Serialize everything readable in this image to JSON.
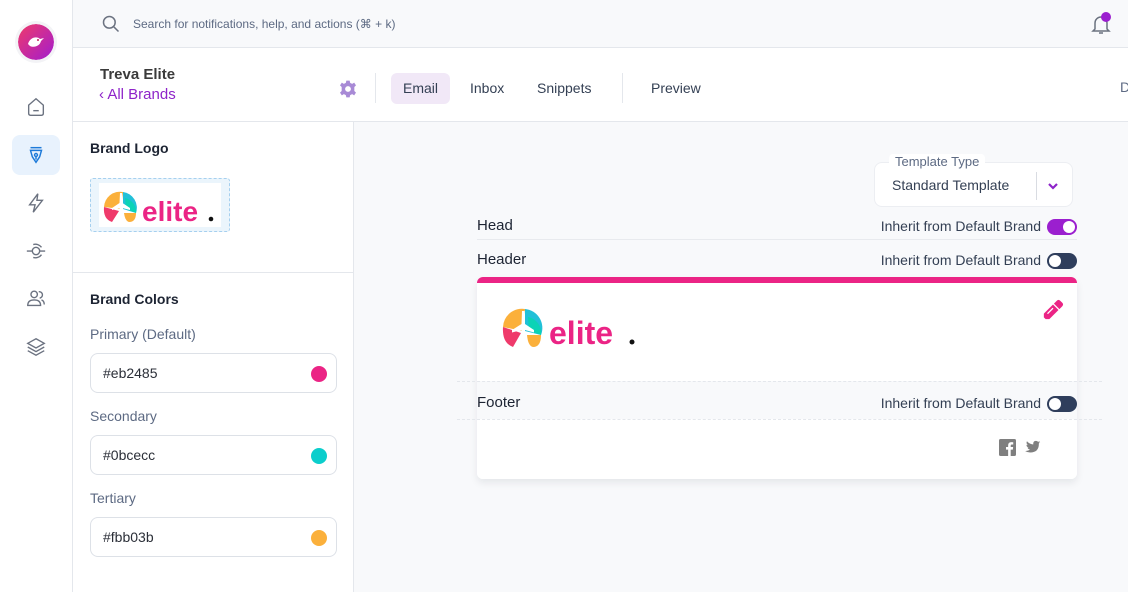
{
  "app": {
    "logo_icon": "bird-logo-icon"
  },
  "rail": {
    "items": [
      {
        "name": "home",
        "icon": "home-icon",
        "active": false
      },
      {
        "name": "brands",
        "icon": "pen-nib-icon",
        "active": true
      },
      {
        "name": "automations",
        "icon": "lightning-icon",
        "active": false
      },
      {
        "name": "integrations",
        "icon": "integration-icon",
        "active": false
      },
      {
        "name": "users",
        "icon": "users-icon",
        "active": false
      },
      {
        "name": "layers",
        "icon": "layers-icon",
        "active": false
      }
    ]
  },
  "topbar": {
    "search_placeholder": "Search for notifications, help, and actions (⌘ + k)",
    "notification_dot": true
  },
  "header": {
    "brand_name": "Treva Elite",
    "back_link": "‹ All Brands",
    "tabs": [
      {
        "label": "Email",
        "active": true
      },
      {
        "label": "Inbox",
        "active": false
      },
      {
        "label": "Snippets",
        "active": false
      },
      {
        "label": "Preview",
        "active": false
      }
    ],
    "cut_off_text": "D"
  },
  "panel": {
    "logo_title": "Brand Logo",
    "logo_text": "elite",
    "colors_title": "Brand Colors",
    "colors": [
      {
        "label": "Primary (Default)",
        "value": "#eb2485",
        "swatch": "#eb2485"
      },
      {
        "label": "Secondary",
        "value": "#0bcecc",
        "swatch": "#0bcecc"
      },
      {
        "label": "Tertiary",
        "value": "#fbb03b",
        "swatch": "#fbb03b"
      }
    ]
  },
  "main": {
    "template_type": {
      "label": "Template Type",
      "value": "Standard Template"
    },
    "sections": [
      {
        "label": "Head",
        "inherit_label": "Inherit from Default Brand",
        "inherit": true
      },
      {
        "label": "Header",
        "inherit_label": "Inherit from Default Brand",
        "inherit": false
      },
      {
        "label": "Footer",
        "inherit_label": "Inherit from Default Brand",
        "inherit": false
      }
    ],
    "preview": {
      "accent": "#eb2485",
      "logo_text": "elite",
      "social": [
        "facebook-icon",
        "twitter-icon"
      ]
    }
  }
}
